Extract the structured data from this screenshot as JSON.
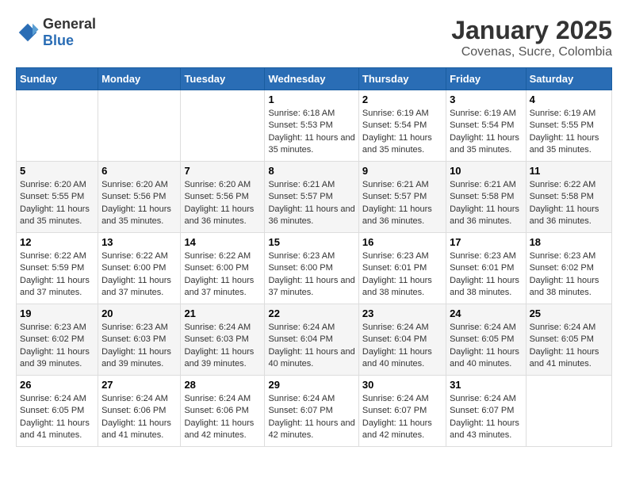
{
  "header": {
    "logo": {
      "general": "General",
      "blue": "Blue"
    },
    "title": "January 2025",
    "subtitle": "Covenas, Sucre, Colombia"
  },
  "calendar": {
    "weekdays": [
      "Sunday",
      "Monday",
      "Tuesday",
      "Wednesday",
      "Thursday",
      "Friday",
      "Saturday"
    ],
    "weeks": [
      [
        {
          "day": "",
          "info": ""
        },
        {
          "day": "",
          "info": ""
        },
        {
          "day": "",
          "info": ""
        },
        {
          "day": "1",
          "sunrise": "6:18 AM",
          "sunset": "5:53 PM",
          "daylight": "11 hours and 35 minutes."
        },
        {
          "day": "2",
          "sunrise": "6:19 AM",
          "sunset": "5:54 PM",
          "daylight": "11 hours and 35 minutes."
        },
        {
          "day": "3",
          "sunrise": "6:19 AM",
          "sunset": "5:54 PM",
          "daylight": "11 hours and 35 minutes."
        },
        {
          "day": "4",
          "sunrise": "6:19 AM",
          "sunset": "5:55 PM",
          "daylight": "11 hours and 35 minutes."
        }
      ],
      [
        {
          "day": "5",
          "sunrise": "6:20 AM",
          "sunset": "5:55 PM",
          "daylight": "11 hours and 35 minutes."
        },
        {
          "day": "6",
          "sunrise": "6:20 AM",
          "sunset": "5:56 PM",
          "daylight": "11 hours and 35 minutes."
        },
        {
          "day": "7",
          "sunrise": "6:20 AM",
          "sunset": "5:56 PM",
          "daylight": "11 hours and 36 minutes."
        },
        {
          "day": "8",
          "sunrise": "6:21 AM",
          "sunset": "5:57 PM",
          "daylight": "11 hours and 36 minutes."
        },
        {
          "day": "9",
          "sunrise": "6:21 AM",
          "sunset": "5:57 PM",
          "daylight": "11 hours and 36 minutes."
        },
        {
          "day": "10",
          "sunrise": "6:21 AM",
          "sunset": "5:58 PM",
          "daylight": "11 hours and 36 minutes."
        },
        {
          "day": "11",
          "sunrise": "6:22 AM",
          "sunset": "5:58 PM",
          "daylight": "11 hours and 36 minutes."
        }
      ],
      [
        {
          "day": "12",
          "sunrise": "6:22 AM",
          "sunset": "5:59 PM",
          "daylight": "11 hours and 37 minutes."
        },
        {
          "day": "13",
          "sunrise": "6:22 AM",
          "sunset": "6:00 PM",
          "daylight": "11 hours and 37 minutes."
        },
        {
          "day": "14",
          "sunrise": "6:22 AM",
          "sunset": "6:00 PM",
          "daylight": "11 hours and 37 minutes."
        },
        {
          "day": "15",
          "sunrise": "6:23 AM",
          "sunset": "6:00 PM",
          "daylight": "11 hours and 37 minutes."
        },
        {
          "day": "16",
          "sunrise": "6:23 AM",
          "sunset": "6:01 PM",
          "daylight": "11 hours and 38 minutes."
        },
        {
          "day": "17",
          "sunrise": "6:23 AM",
          "sunset": "6:01 PM",
          "daylight": "11 hours and 38 minutes."
        },
        {
          "day": "18",
          "sunrise": "6:23 AM",
          "sunset": "6:02 PM",
          "daylight": "11 hours and 38 minutes."
        }
      ],
      [
        {
          "day": "19",
          "sunrise": "6:23 AM",
          "sunset": "6:02 PM",
          "daylight": "11 hours and 39 minutes."
        },
        {
          "day": "20",
          "sunrise": "6:23 AM",
          "sunset": "6:03 PM",
          "daylight": "11 hours and 39 minutes."
        },
        {
          "day": "21",
          "sunrise": "6:24 AM",
          "sunset": "6:03 PM",
          "daylight": "11 hours and 39 minutes."
        },
        {
          "day": "22",
          "sunrise": "6:24 AM",
          "sunset": "6:04 PM",
          "daylight": "11 hours and 40 minutes."
        },
        {
          "day": "23",
          "sunrise": "6:24 AM",
          "sunset": "6:04 PM",
          "daylight": "11 hours and 40 minutes."
        },
        {
          "day": "24",
          "sunrise": "6:24 AM",
          "sunset": "6:05 PM",
          "daylight": "11 hours and 40 minutes."
        },
        {
          "day": "25",
          "sunrise": "6:24 AM",
          "sunset": "6:05 PM",
          "daylight": "11 hours and 41 minutes."
        }
      ],
      [
        {
          "day": "26",
          "sunrise": "6:24 AM",
          "sunset": "6:05 PM",
          "daylight": "11 hours and 41 minutes."
        },
        {
          "day": "27",
          "sunrise": "6:24 AM",
          "sunset": "6:06 PM",
          "daylight": "11 hours and 41 minutes."
        },
        {
          "day": "28",
          "sunrise": "6:24 AM",
          "sunset": "6:06 PM",
          "daylight": "11 hours and 42 minutes."
        },
        {
          "day": "29",
          "sunrise": "6:24 AM",
          "sunset": "6:07 PM",
          "daylight": "11 hours and 42 minutes."
        },
        {
          "day": "30",
          "sunrise": "6:24 AM",
          "sunset": "6:07 PM",
          "daylight": "11 hours and 42 minutes."
        },
        {
          "day": "31",
          "sunrise": "6:24 AM",
          "sunset": "6:07 PM",
          "daylight": "11 hours and 43 minutes."
        },
        {
          "day": "",
          "info": ""
        }
      ]
    ]
  }
}
